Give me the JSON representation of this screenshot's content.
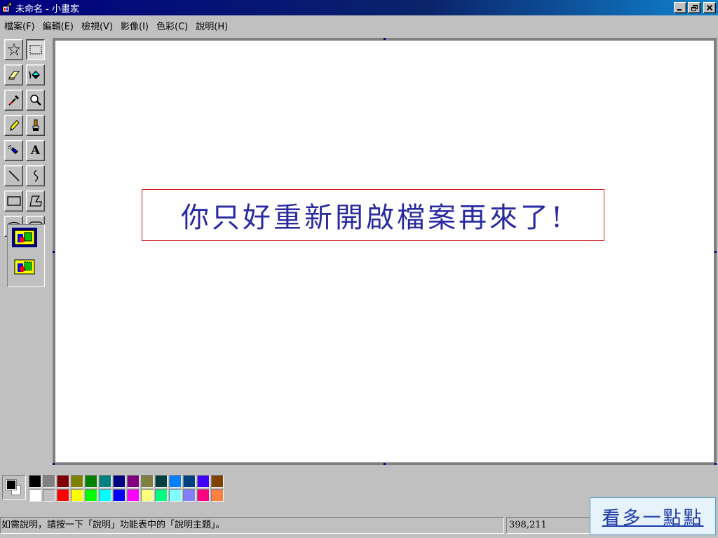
{
  "window": {
    "title": "未命名 - 小畫家",
    "minimize_label": "_",
    "restore_label": "🗗",
    "close_label": "✕"
  },
  "menubar": {
    "items": [
      "檔案(F)",
      "編輯(E)",
      "檢視(V)",
      "影像(I)",
      "色彩(C)",
      "說明(H)"
    ]
  },
  "toolbox": {
    "tools": [
      {
        "name": "free-form-select-icon"
      },
      {
        "name": "select-icon"
      },
      {
        "name": "eraser-icon"
      },
      {
        "name": "fill-icon"
      },
      {
        "name": "pick-color-icon"
      },
      {
        "name": "magnifier-icon"
      },
      {
        "name": "pencil-icon"
      },
      {
        "name": "brush-icon"
      },
      {
        "name": "airbrush-icon"
      },
      {
        "name": "text-icon",
        "glyph": "A"
      },
      {
        "name": "line-icon"
      },
      {
        "name": "curve-icon"
      },
      {
        "name": "rectangle-icon"
      },
      {
        "name": "polygon-icon"
      },
      {
        "name": "ellipse-icon"
      },
      {
        "name": "rounded-rectangle-icon"
      }
    ]
  },
  "canvas": {
    "message": "你只好重新開啟檔案再來了!"
  },
  "palette": {
    "foreground": "#000000",
    "background": "#ffffff",
    "colors_top": [
      "#000000",
      "#808080",
      "#800000",
      "#808000",
      "#008000",
      "#008080",
      "#000080",
      "#800080",
      "#808040",
      "#004040",
      "#0080ff",
      "#004080",
      "#4000ff",
      "#804000"
    ],
    "colors_bottom": [
      "#ffffff",
      "#c0c0c0",
      "#ff0000",
      "#ffff00",
      "#00ff00",
      "#00ffff",
      "#0000ff",
      "#ff00ff",
      "#ffff80",
      "#00ff80",
      "#80ffff",
      "#8080ff",
      "#ff0080",
      "#ff8040"
    ]
  },
  "statusbar": {
    "help_text": "如需說明，請按一下「說明」功能表中的「說明主題」。",
    "coordinates": "398,211"
  },
  "see_more": {
    "label": "看多一點點"
  }
}
